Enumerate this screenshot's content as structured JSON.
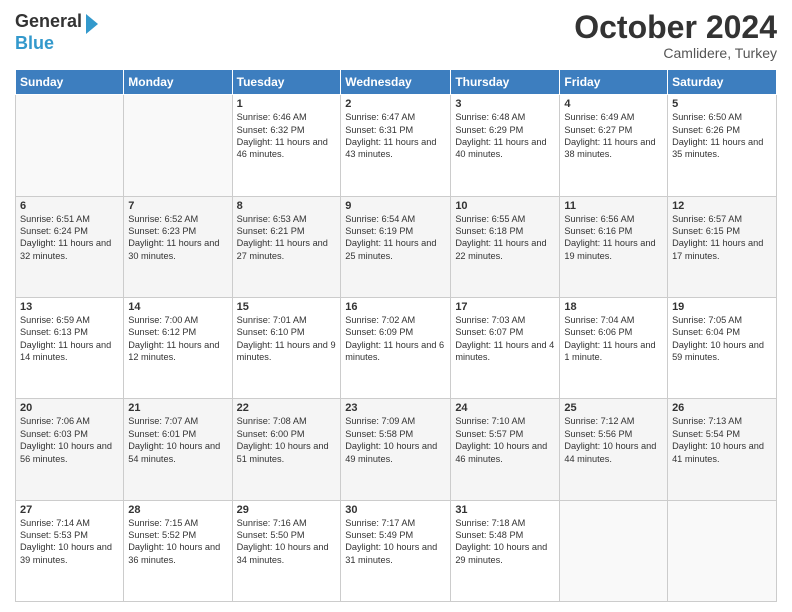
{
  "header": {
    "logo_line1": "General",
    "logo_line2": "Blue",
    "month": "October 2024",
    "location": "Camlidere, Turkey"
  },
  "days_of_week": [
    "Sunday",
    "Monday",
    "Tuesday",
    "Wednesday",
    "Thursday",
    "Friday",
    "Saturday"
  ],
  "weeks": [
    [
      {
        "num": "",
        "info": ""
      },
      {
        "num": "",
        "info": ""
      },
      {
        "num": "1",
        "info": "Sunrise: 6:46 AM\nSunset: 6:32 PM\nDaylight: 11 hours and 46 minutes."
      },
      {
        "num": "2",
        "info": "Sunrise: 6:47 AM\nSunset: 6:31 PM\nDaylight: 11 hours and 43 minutes."
      },
      {
        "num": "3",
        "info": "Sunrise: 6:48 AM\nSunset: 6:29 PM\nDaylight: 11 hours and 40 minutes."
      },
      {
        "num": "4",
        "info": "Sunrise: 6:49 AM\nSunset: 6:27 PM\nDaylight: 11 hours and 38 minutes."
      },
      {
        "num": "5",
        "info": "Sunrise: 6:50 AM\nSunset: 6:26 PM\nDaylight: 11 hours and 35 minutes."
      }
    ],
    [
      {
        "num": "6",
        "info": "Sunrise: 6:51 AM\nSunset: 6:24 PM\nDaylight: 11 hours and 32 minutes."
      },
      {
        "num": "7",
        "info": "Sunrise: 6:52 AM\nSunset: 6:23 PM\nDaylight: 11 hours and 30 minutes."
      },
      {
        "num": "8",
        "info": "Sunrise: 6:53 AM\nSunset: 6:21 PM\nDaylight: 11 hours and 27 minutes."
      },
      {
        "num": "9",
        "info": "Sunrise: 6:54 AM\nSunset: 6:19 PM\nDaylight: 11 hours and 25 minutes."
      },
      {
        "num": "10",
        "info": "Sunrise: 6:55 AM\nSunset: 6:18 PM\nDaylight: 11 hours and 22 minutes."
      },
      {
        "num": "11",
        "info": "Sunrise: 6:56 AM\nSunset: 6:16 PM\nDaylight: 11 hours and 19 minutes."
      },
      {
        "num": "12",
        "info": "Sunrise: 6:57 AM\nSunset: 6:15 PM\nDaylight: 11 hours and 17 minutes."
      }
    ],
    [
      {
        "num": "13",
        "info": "Sunrise: 6:59 AM\nSunset: 6:13 PM\nDaylight: 11 hours and 14 minutes."
      },
      {
        "num": "14",
        "info": "Sunrise: 7:00 AM\nSunset: 6:12 PM\nDaylight: 11 hours and 12 minutes."
      },
      {
        "num": "15",
        "info": "Sunrise: 7:01 AM\nSunset: 6:10 PM\nDaylight: 11 hours and 9 minutes."
      },
      {
        "num": "16",
        "info": "Sunrise: 7:02 AM\nSunset: 6:09 PM\nDaylight: 11 hours and 6 minutes."
      },
      {
        "num": "17",
        "info": "Sunrise: 7:03 AM\nSunset: 6:07 PM\nDaylight: 11 hours and 4 minutes."
      },
      {
        "num": "18",
        "info": "Sunrise: 7:04 AM\nSunset: 6:06 PM\nDaylight: 11 hours and 1 minute."
      },
      {
        "num": "19",
        "info": "Sunrise: 7:05 AM\nSunset: 6:04 PM\nDaylight: 10 hours and 59 minutes."
      }
    ],
    [
      {
        "num": "20",
        "info": "Sunrise: 7:06 AM\nSunset: 6:03 PM\nDaylight: 10 hours and 56 minutes."
      },
      {
        "num": "21",
        "info": "Sunrise: 7:07 AM\nSunset: 6:01 PM\nDaylight: 10 hours and 54 minutes."
      },
      {
        "num": "22",
        "info": "Sunrise: 7:08 AM\nSunset: 6:00 PM\nDaylight: 10 hours and 51 minutes."
      },
      {
        "num": "23",
        "info": "Sunrise: 7:09 AM\nSunset: 5:58 PM\nDaylight: 10 hours and 49 minutes."
      },
      {
        "num": "24",
        "info": "Sunrise: 7:10 AM\nSunset: 5:57 PM\nDaylight: 10 hours and 46 minutes."
      },
      {
        "num": "25",
        "info": "Sunrise: 7:12 AM\nSunset: 5:56 PM\nDaylight: 10 hours and 44 minutes."
      },
      {
        "num": "26",
        "info": "Sunrise: 7:13 AM\nSunset: 5:54 PM\nDaylight: 10 hours and 41 minutes."
      }
    ],
    [
      {
        "num": "27",
        "info": "Sunrise: 7:14 AM\nSunset: 5:53 PM\nDaylight: 10 hours and 39 minutes."
      },
      {
        "num": "28",
        "info": "Sunrise: 7:15 AM\nSunset: 5:52 PM\nDaylight: 10 hours and 36 minutes."
      },
      {
        "num": "29",
        "info": "Sunrise: 7:16 AM\nSunset: 5:50 PM\nDaylight: 10 hours and 34 minutes."
      },
      {
        "num": "30",
        "info": "Sunrise: 7:17 AM\nSunset: 5:49 PM\nDaylight: 10 hours and 31 minutes."
      },
      {
        "num": "31",
        "info": "Sunrise: 7:18 AM\nSunset: 5:48 PM\nDaylight: 10 hours and 29 minutes."
      },
      {
        "num": "",
        "info": ""
      },
      {
        "num": "",
        "info": ""
      }
    ]
  ]
}
